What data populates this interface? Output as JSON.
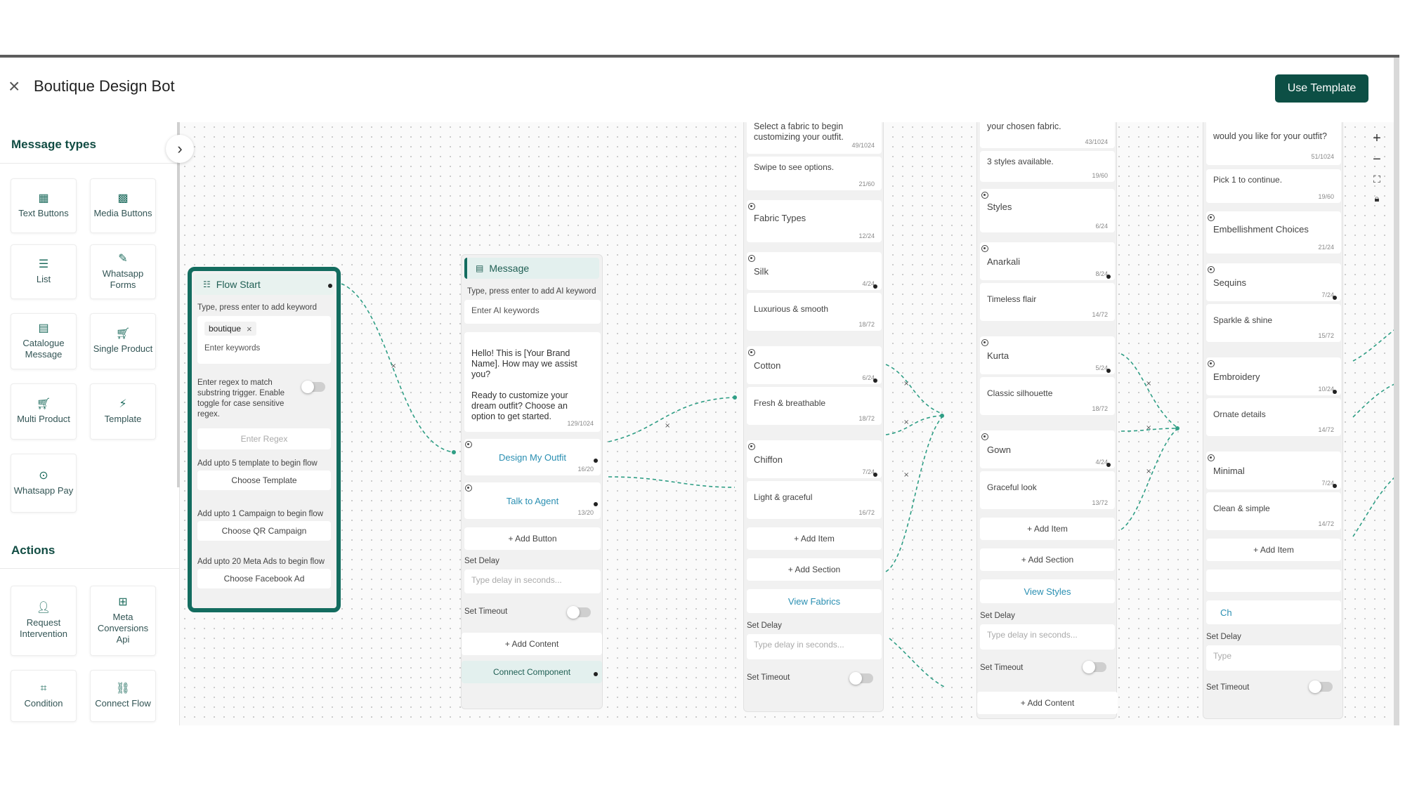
{
  "window": {
    "title": "Boutique Design Bot",
    "use_template_label": "Use Template"
  },
  "sidebar": {
    "message_types_title": "Message types",
    "actions_title": "Actions",
    "message_types": [
      {
        "label": "Text Buttons",
        "icon": "text-buttons-icon"
      },
      {
        "label": "Media Buttons",
        "icon": "media-buttons-icon"
      },
      {
        "label": "List",
        "icon": "list-icon"
      },
      {
        "label": "Whatsapp Forms",
        "icon": "forms-icon"
      },
      {
        "label": "Catalogue Message",
        "icon": "catalogue-icon"
      },
      {
        "label": "Single Product",
        "icon": "cart-icon"
      },
      {
        "label": "Multi Product",
        "icon": "cart-icon"
      },
      {
        "label": "Template",
        "icon": "bolt-icon"
      },
      {
        "label": "Whatsapp Pay",
        "icon": "pay-icon"
      }
    ],
    "actions": [
      {
        "label": "Request Intervention",
        "icon": "person-icon"
      },
      {
        "label": "Meta Conversions Api",
        "icon": "conversions-icon"
      },
      {
        "label": "Condition",
        "icon": "condition-icon"
      },
      {
        "label": "Connect Flow",
        "icon": "flow-icon"
      }
    ]
  },
  "flow_start": {
    "title": "Flow Start",
    "keyword_hint": "Type, press enter to add keyword",
    "keyword_chip": "boutique",
    "keyword_placeholder": "Enter keywords",
    "regex_hint": "Enter regex to match substring trigger. Enable toggle for case sensitive regex.",
    "regex_placeholder": "Enter Regex",
    "template_hint": "Add upto 5 template to begin flow",
    "template_btn": "Choose Template",
    "campaign_hint": "Add upto 1 Campaign to begin flow",
    "campaign_btn": "Choose QR Campaign",
    "ads_hint": "Add upto 20 Meta Ads to begin flow",
    "ads_btn": "Choose Facebook Ad"
  },
  "message_node": {
    "title": "Message",
    "ai_hint": "Type, press enter to add AI keyword",
    "ai_placeholder": "Enter AI keywords",
    "body": "Hello! This is [Your Brand Name]. How may we assist you?\n\nReady to customize your dream outfit? Choose an option to get started.",
    "body_count": "129/1024",
    "buttons": [
      {
        "label": "Design My Outfit",
        "count": "16/20"
      },
      {
        "label": "Talk to Agent",
        "count": "13/20"
      }
    ],
    "add_button": "+ Add Button",
    "set_delay": "Set Delay",
    "delay_placeholder": "Type delay in seconds...",
    "set_timeout": "Set Timeout",
    "add_content": "+ Add Content",
    "connect_component": "Connect Component"
  },
  "fabric_node": {
    "body_partial": "Select a fabric to begin customizing your outfit.",
    "body_count": "49/1024",
    "footer": "Swipe to see options.",
    "footer_count": "21/60",
    "section_title": "Fabric Types",
    "section_count": "12/24",
    "items": [
      {
        "title": "Silk",
        "title_count": "4/24",
        "desc": "Luxurious & smooth",
        "desc_count": "18/72"
      },
      {
        "title": "Cotton",
        "title_count": "6/24",
        "desc": "Fresh & breathable",
        "desc_count": "18/72"
      },
      {
        "title": "Chiffon",
        "title_count": "7/24",
        "desc": "Light & graceful",
        "desc_count": "16/72"
      }
    ],
    "add_item": "+ Add Item",
    "add_section": "+ Add Section",
    "button_label": "View Fabrics",
    "set_delay": "Set Delay",
    "delay_placeholder": "Type delay in seconds...",
    "set_timeout": "Set Timeout"
  },
  "style_node": {
    "body_partial": "your chosen fabric.",
    "body_count": "43/1024",
    "footer": "3 styles available.",
    "footer_count": "19/60",
    "section_title": "Styles",
    "section_count": "6/24",
    "items": [
      {
        "title": "Anarkali",
        "title_count": "8/24",
        "desc": "Timeless flair",
        "desc_count": "14/72"
      },
      {
        "title": "Kurta",
        "title_count": "5/24",
        "desc": "Classic silhouette",
        "desc_count": "18/72"
      },
      {
        "title": "Gown",
        "title_count": "4/24",
        "desc": "Graceful look",
        "desc_count": "13/72"
      }
    ],
    "add_item": "+ Add Item",
    "add_section": "+ Add Section",
    "button_label": "View Styles",
    "set_delay": "Set Delay",
    "delay_placeholder": "Type delay in seconds...",
    "set_timeout": "Set Timeout",
    "add_content": "+ Add Content"
  },
  "embellishment_node": {
    "body_partial": "would you like for your outfit?",
    "body_count": "51/1024",
    "footer": "Pick 1 to continue.",
    "footer_count": "19/60",
    "section_title": "Embellishment Choices",
    "section_count": "21/24",
    "items": [
      {
        "title": "Sequins",
        "title_count": "7/24",
        "desc": "Sparkle & shine",
        "desc_count": "15/72"
      },
      {
        "title": "Embroidery",
        "title_count": "10/24",
        "desc": "Ornate details",
        "desc_count": "14/72"
      },
      {
        "title": "Minimal",
        "title_count": "7/24",
        "desc": "Clean & simple",
        "desc_count": "14/72"
      }
    ],
    "add_item": "+ Add Item",
    "button_partial": "Ch",
    "set_delay": "Set Delay",
    "delay_partial": "Type",
    "set_timeout": "Set Timeout"
  },
  "zoom": {
    "in": "+",
    "out": "−"
  },
  "colors": {
    "brand": "#0d4f45",
    "accent": "#136c5f",
    "link": "#2a8fb2",
    "edge": "#2f9e85"
  }
}
